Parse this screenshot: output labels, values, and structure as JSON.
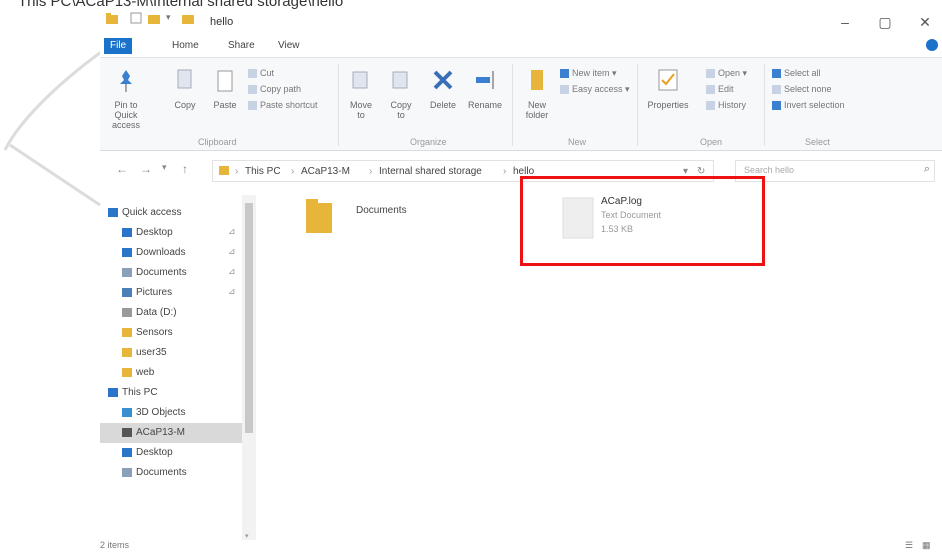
{
  "caption": "This PC\\ACaP13-M\\Internal shared storage\\hello",
  "window": {
    "title": "hello",
    "controls": {
      "minimize": "–",
      "maximize": "▢",
      "close": "✕"
    }
  },
  "tabs": [
    "File",
    "Home",
    "Share",
    "View"
  ],
  "ribbon": {
    "clipboard": {
      "pin": "Pin to Quick access",
      "copy": "Copy",
      "paste": "Paste",
      "cut": "Cut",
      "copy_path": "Copy path",
      "paste_shortcut": "Paste shortcut",
      "label": "Clipboard"
    },
    "organize": {
      "move_to": "Move to",
      "copy_to": "Copy to",
      "delete": "Delete",
      "rename": "Rename",
      "label": "Organize"
    },
    "new": {
      "new_folder": "New folder",
      "new_item": "New item",
      "easy_access": "Easy access",
      "label": "New"
    },
    "open": {
      "properties": "Properties",
      "open": "Open",
      "edit": "Edit",
      "history": "History",
      "label": "Open"
    },
    "select": {
      "select_all": "Select all",
      "select_none": "Select none",
      "invert": "Invert selection",
      "label": "Select"
    }
  },
  "address": {
    "crumbs": [
      "This PC",
      "ACaP13-M",
      "Internal shared storage",
      "hello"
    ],
    "search_placeholder": "Search hello"
  },
  "nav": {
    "items": [
      {
        "label": "Quick access",
        "icon": "star-icon",
        "color": "#2a74c9"
      },
      {
        "label": "Desktop",
        "icon": "desktop-icon",
        "color": "#2a74c9",
        "pinned": true
      },
      {
        "label": "Downloads",
        "icon": "download-icon",
        "color": "#2a74c9",
        "pinned": true
      },
      {
        "label": "Documents",
        "icon": "document-icon",
        "color": "#8aa0b8",
        "pinned": true
      },
      {
        "label": "Pictures",
        "icon": "picture-icon",
        "color": "#4a7fb8",
        "pinned": true
      },
      {
        "label": "Data (D:)",
        "icon": "drive-icon",
        "color": "#9a9a9a"
      },
      {
        "label": "Sensors",
        "icon": "folder-icon",
        "color": "#e6b53a"
      },
      {
        "label": "user35",
        "icon": "folder-icon",
        "color": "#e6b53a"
      },
      {
        "label": "web",
        "icon": "folder-icon",
        "color": "#e6b53a"
      },
      {
        "label": "This PC",
        "icon": "computer-icon",
        "color": "#2a74c9"
      },
      {
        "label": "3D Objects",
        "icon": "cube-icon",
        "color": "#3a8fd0"
      },
      {
        "label": "ACaP13-M",
        "icon": "phone-icon",
        "color": "#555555",
        "selected": true
      },
      {
        "label": "Desktop",
        "icon": "desktop-icon",
        "color": "#2a74c9"
      },
      {
        "label": "Documents",
        "icon": "document-icon",
        "color": "#8aa0b8"
      }
    ],
    "pin_glyph": "⊿"
  },
  "content": {
    "folder": {
      "name": "Documents"
    },
    "file": {
      "name": "ACaP.log",
      "type": "Text Document",
      "size": "1.53 KB"
    }
  },
  "status": {
    "items": "2 items"
  },
  "colors": {
    "accent": "#1a73c9",
    "highlight": "#ee1111",
    "folder": "#e6b53a"
  }
}
